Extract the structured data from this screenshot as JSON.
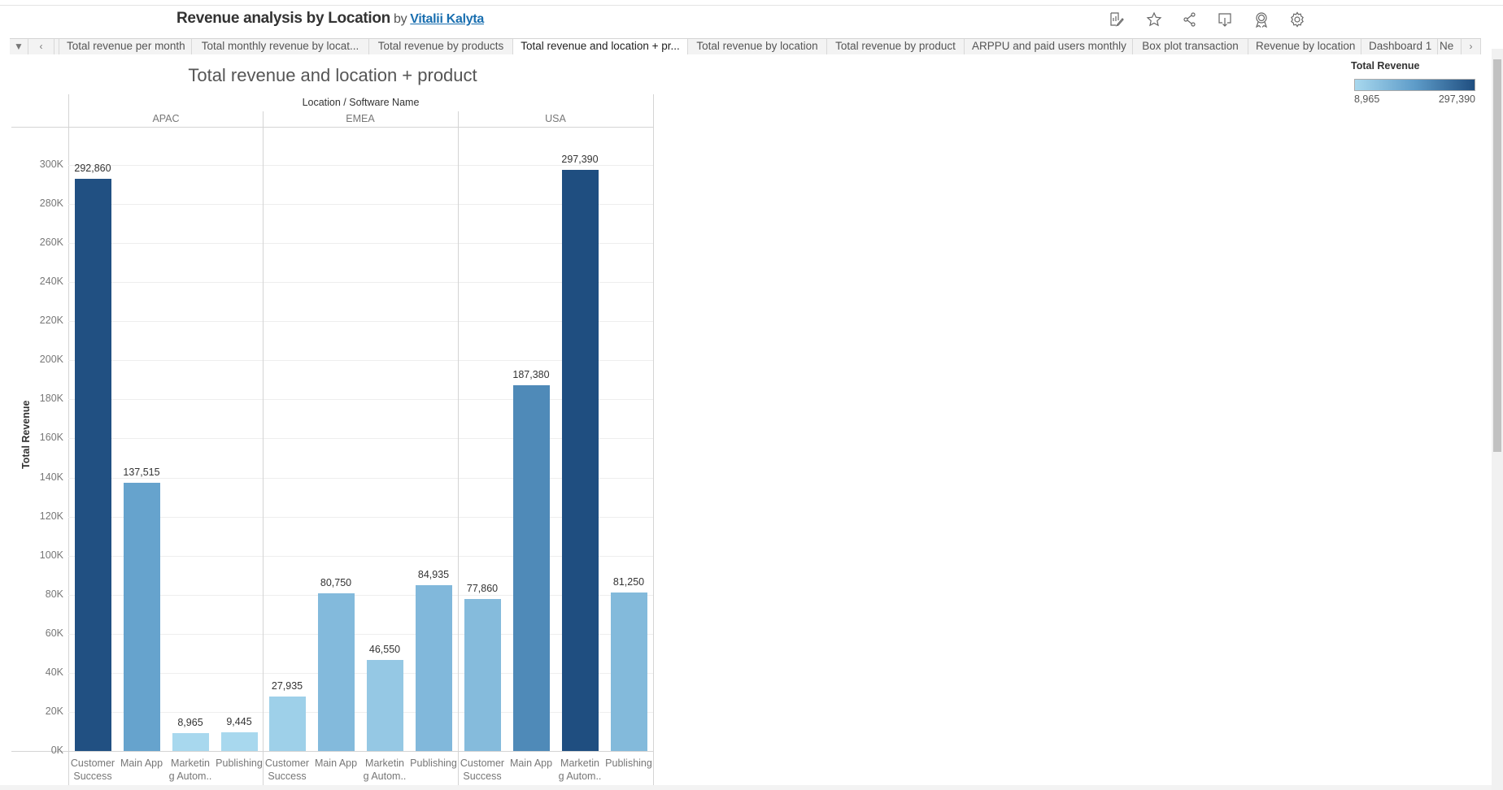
{
  "header": {
    "title": "Revenue analysis by Location",
    "by": "by",
    "author": "Vitalii Kalyta",
    "icons": [
      "edit-icon",
      "favorite-star-icon",
      "share-icon",
      "download-icon",
      "metrics-badge-icon",
      "settings-gear-icon"
    ]
  },
  "tabs": {
    "dropdown": "▼",
    "prev": "‹",
    "next": "›",
    "items": [
      {
        "label": "Total revenue per month"
      },
      {
        "label": "Total monthly revenue by locat..."
      },
      {
        "label": "Total revenue by products"
      },
      {
        "label": "Total revenue and location + pr...",
        "active": true
      },
      {
        "label": "Total revenue by location"
      },
      {
        "label": "Total revenue by product"
      },
      {
        "label": "ARPPU and paid users monthly"
      },
      {
        "label": "Box plot transaction"
      },
      {
        "label": "Revenue by location"
      },
      {
        "label": "Dashboard 1"
      },
      {
        "label": "Ne"
      }
    ]
  },
  "legend": {
    "title": "Total Revenue",
    "min": "8,965",
    "max": "297,390",
    "colors": [
      "#a8d8ee",
      "#5e9cc9",
      "#1f4e80"
    ]
  },
  "chart_data": {
    "type": "bar",
    "title": "Total revenue and location + product",
    "header": "Location / Software Name",
    "ylabel": "Total Revenue",
    "ylim": [
      0,
      300000
    ],
    "yticks": [
      "0K",
      "20K",
      "40K",
      "60K",
      "80K",
      "100K",
      "120K",
      "140K",
      "160K",
      "180K",
      "200K",
      "220K",
      "240K",
      "260K",
      "280K",
      "300K"
    ],
    "grid": true,
    "groups": [
      {
        "name": "APAC",
        "bars": [
          {
            "category": [
              "Customer",
              "Success"
            ],
            "value": 292860,
            "label": "292,860"
          },
          {
            "category": [
              "Main App",
              ""
            ],
            "value": 137515,
            "label": "137,515"
          },
          {
            "category": [
              "Marketin",
              "g Autom.."
            ],
            "value": 8965,
            "label": "8,965"
          },
          {
            "category": [
              "Publishing",
              ""
            ],
            "value": 9445,
            "label": "9,445"
          }
        ]
      },
      {
        "name": "EMEA",
        "bars": [
          {
            "category": [
              "Customer",
              "Success"
            ],
            "value": 27935,
            "label": "27,935"
          },
          {
            "category": [
              "Main App",
              ""
            ],
            "value": 80750,
            "label": "80,750"
          },
          {
            "category": [
              "Marketin",
              "g Autom.."
            ],
            "value": 46550,
            "label": "46,550"
          },
          {
            "category": [
              "Publishing",
              ""
            ],
            "value": 84935,
            "label": "84,935"
          }
        ]
      },
      {
        "name": "USA",
        "bars": [
          {
            "category": [
              "Customer",
              "Success"
            ],
            "value": 77860,
            "label": "77,860"
          },
          {
            "category": [
              "Main App",
              ""
            ],
            "value": 187380,
            "label": "187,380"
          },
          {
            "category": [
              "Marketin",
              "g Autom.."
            ],
            "value": 297390,
            "label": "297,390"
          },
          {
            "category": [
              "Publishing",
              ""
            ],
            "value": 81250,
            "label": "81,250"
          }
        ]
      }
    ]
  }
}
